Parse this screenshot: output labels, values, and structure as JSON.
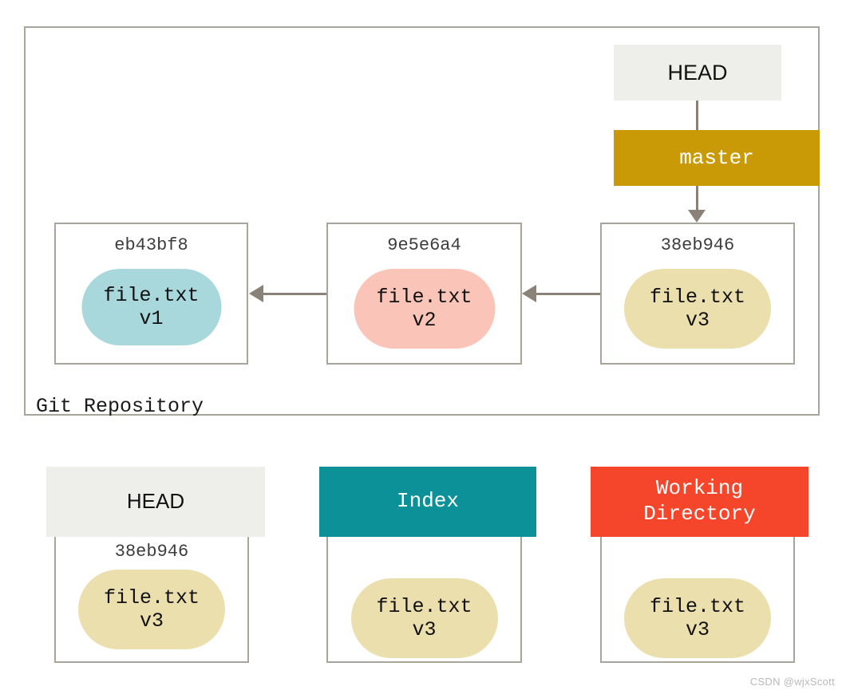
{
  "diagram": {
    "repository": {
      "label": "Git Repository",
      "head_pointer": "HEAD",
      "branch": "master",
      "commits": [
        {
          "hash": "eb43bf8",
          "file": "file.txt",
          "version": "v1",
          "color": "#a8d8dc"
        },
        {
          "hash": "9e5e6a4",
          "file": "file.txt",
          "version": "v2",
          "color": "#fac5b8"
        },
        {
          "hash": "38eb946",
          "file": "file.txt",
          "version": "v3",
          "color": "#ecdfae"
        }
      ]
    },
    "areas": [
      {
        "title": "HEAD",
        "hash": "38eb946",
        "file": "file.txt",
        "version": "v3",
        "header_color": "#eeeeea",
        "header_text_color": "#111111"
      },
      {
        "title": "Index",
        "hash": "",
        "file": "file.txt",
        "version": "v3",
        "header_color": "#0d9199",
        "header_text_color": "#ffffff"
      },
      {
        "title_line1": "Working",
        "title_line2": "Directory",
        "hash": "",
        "file": "file.txt",
        "version": "v3",
        "header_color": "#f5452a",
        "header_text_color": "#ffffff"
      }
    ],
    "colors": {
      "border": "#a9a49c",
      "connector": "#8a8279",
      "branch_bar": "#c99a06",
      "blob_v1": "#a8d8dc",
      "blob_v2": "#fac5b8",
      "blob_v3": "#ecdfae",
      "index_teal": "#0d9199",
      "working_orange": "#f5452a",
      "head_gray": "#eeeeea"
    }
  },
  "watermark": "CSDN @wjxScott"
}
